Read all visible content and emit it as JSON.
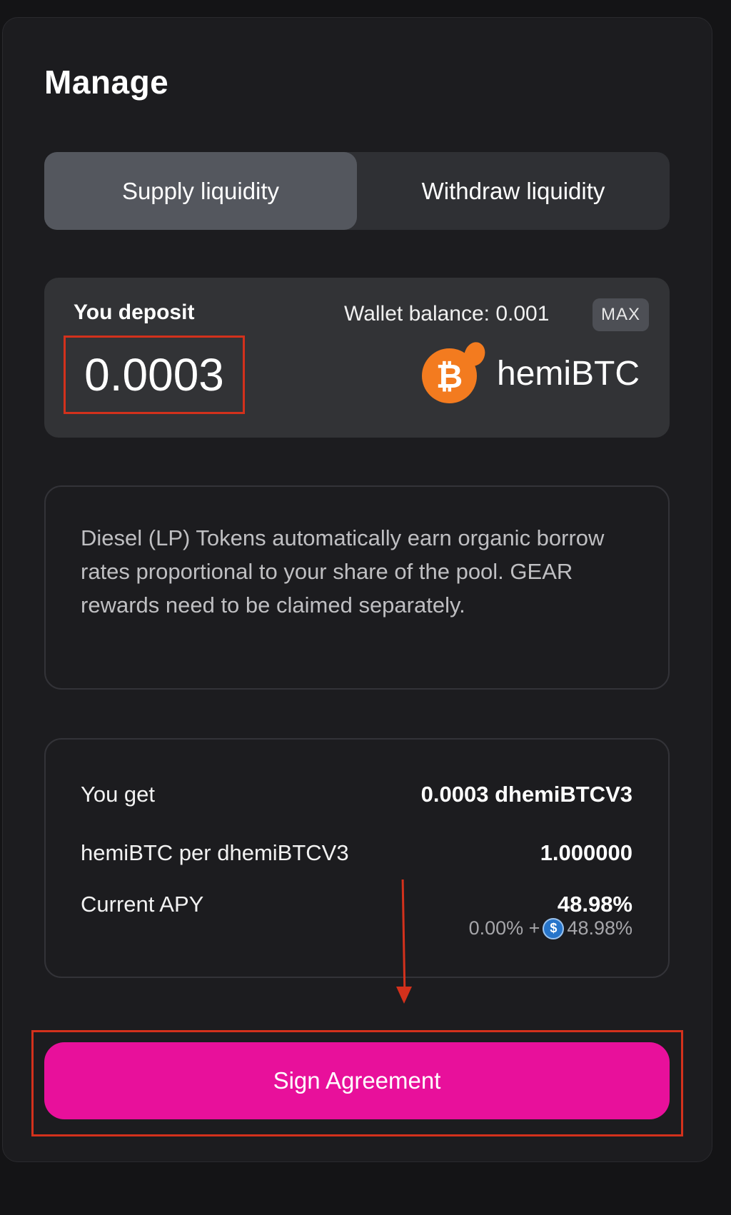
{
  "header": {
    "title": "Manage"
  },
  "tabs": [
    {
      "label": "Supply liquidity",
      "active": true
    },
    {
      "label": "Withdraw liquidity",
      "active": false
    }
  ],
  "deposit": {
    "label": "You deposit",
    "wallet_balance": "Wallet balance: 0.001",
    "max_label": "MAX",
    "amount": "0.0003",
    "token": "hemiBTC",
    "token_icon": "bitcoin-coin-icon",
    "token_glyph": "₿"
  },
  "info": {
    "text": "Diesel (LP) Tokens automatically earn organic borrow rates proportional to your share of the pool. GEAR rewards need to be claimed separately."
  },
  "summary": {
    "you_get_label": "You get",
    "you_get_value": "0.0003 dhemiBTCV3",
    "rate_label": "hemiBTC per dhemiBTCV3",
    "rate_value": "1.000000",
    "apy_label": "Current APY",
    "apy_value": "48.98%",
    "apy_base": "0.00% +",
    "apy_reward_glyph": "$",
    "apy_reward": "48.98%",
    "apy_reward_icon": "usdc-icon"
  },
  "cta": {
    "label": "Sign Agreement"
  },
  "colors": {
    "accent": "#e8109b",
    "annotation": "#d3311c",
    "token": "#f37b1f"
  }
}
